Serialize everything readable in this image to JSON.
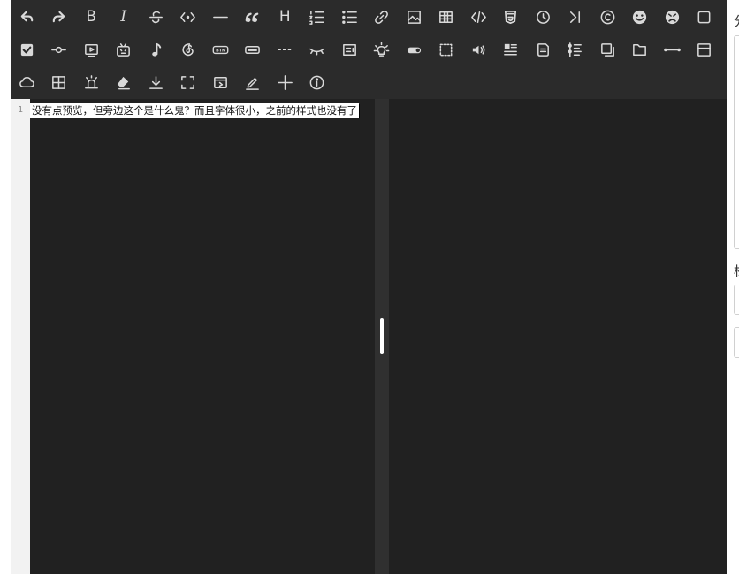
{
  "toolbar": {
    "bold_label": "B",
    "italic_label": "I",
    "heading_label": "H",
    "btn_badge": "BTN",
    "more_label": "---"
  },
  "editor": {
    "line_number": "1",
    "line_text": "没有点预览，但旁边这个是什么鬼？而且字体很小，之前的样式也没有了"
  },
  "side_panel": {
    "label_1": "分",
    "label_2": "标"
  }
}
